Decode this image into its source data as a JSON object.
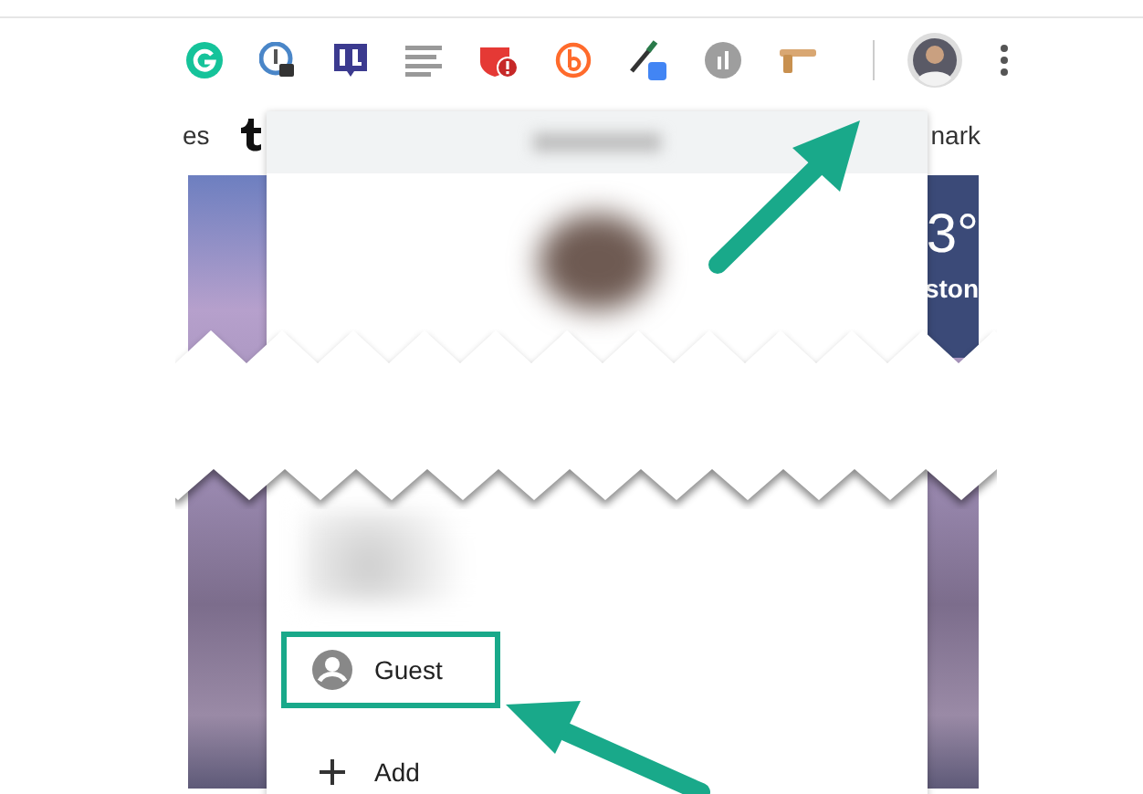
{
  "bookmarks_bar": {
    "items": [
      {
        "label": "es"
      },
      {
        "label": "nark"
      }
    ]
  },
  "weather": {
    "temperature": "3°",
    "location": "ston"
  },
  "profile_menu": {
    "items": [
      {
        "kind": "guest",
        "label": "Guest",
        "highlighted": true
      },
      {
        "kind": "add",
        "label": "Add",
        "highlighted": false
      }
    ]
  }
}
